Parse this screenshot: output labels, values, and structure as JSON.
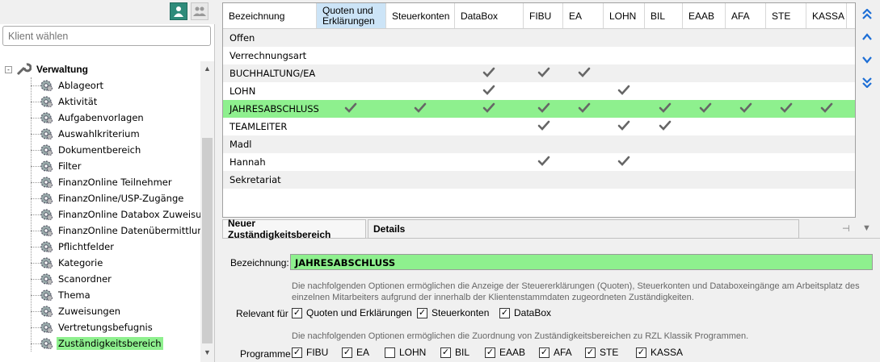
{
  "search": {
    "placeholder": "Klient wählen"
  },
  "tree": {
    "root": "Verwaltung",
    "items": [
      "Ablageort",
      "Aktivität",
      "Aufgabenvorlagen",
      "Auswahlkriterium",
      "Dokumentbereich",
      "Filter",
      "FinanzOnline Teilnehmer",
      "FinanzOnline/USP-Zugänge",
      "FinanzOnline Databox Zuweisungen",
      "FinanzOnline Datenübermittlungen",
      "Pflichtfelder",
      "Kategorie",
      "Scanordner",
      "Thema",
      "Zuweisungen",
      "Vertretungsbefugnis",
      "Zuständigkeitsbereich"
    ],
    "selected": "Zuständigkeitsbereich"
  },
  "grid": {
    "columns": [
      "Bezeichnung",
      "Quoten und Erklärungen",
      "Steuerkonten",
      "DataBox",
      "FIBU",
      "EA",
      "LOHN",
      "BIL",
      "EAAB",
      "AFA",
      "STE",
      "KASSA"
    ],
    "rows": [
      {
        "label": "Offen",
        "checks": [
          0,
          0,
          0,
          0,
          0,
          0,
          0,
          0,
          0,
          0,
          0
        ]
      },
      {
        "label": "Verrechnungsart",
        "checks": [
          0,
          0,
          0,
          0,
          0,
          0,
          0,
          0,
          0,
          0,
          0
        ]
      },
      {
        "label": "BUCHHALTUNG/EA",
        "checks": [
          0,
          0,
          1,
          1,
          1,
          0,
          0,
          0,
          0,
          0,
          0
        ]
      },
      {
        "label": "LOHN",
        "checks": [
          0,
          0,
          1,
          0,
          0,
          1,
          0,
          0,
          0,
          0,
          0
        ]
      },
      {
        "label": "JAHRESABSCHLUSS",
        "checks": [
          1,
          1,
          1,
          1,
          1,
          0,
          1,
          1,
          1,
          1,
          1
        ]
      },
      {
        "label": "TEAMLEITER",
        "checks": [
          0,
          0,
          0,
          1,
          0,
          1,
          1,
          0,
          0,
          0,
          0
        ]
      },
      {
        "label": "Madl",
        "checks": [
          0,
          0,
          0,
          0,
          0,
          0,
          0,
          0,
          0,
          0,
          0
        ]
      },
      {
        "label": "Hannah",
        "checks": [
          0,
          0,
          0,
          1,
          0,
          1,
          0,
          0,
          0,
          0,
          0
        ]
      },
      {
        "label": "Sekretariat",
        "checks": [
          0,
          0,
          0,
          0,
          0,
          0,
          0,
          0,
          0,
          0,
          0
        ]
      }
    ],
    "highlight_row": "JAHRESABSCHLUSS"
  },
  "tabs": {
    "new": "Neuer Zuständigkeitsbereich",
    "details": "Details"
  },
  "detail": {
    "bez_label": "Bezeichnung:",
    "bez_value": "JAHRESABSCHLUSS",
    "info1": "Die nachfolgenden Optionen ermöglichen die Anzeige der Steuererklärungen (Quoten), Steuerkonten und Databoxeingänge am Arbeitsplatz des einzelnen Mitarbeiters aufgrund der innerhalb der Klientenstammdaten zugeordneten Zuständigkeiten.",
    "relevant_label": "Relevant für",
    "relevant": [
      {
        "label": "Quoten und Erklärungen",
        "checked": true
      },
      {
        "label": "Steuerkonten",
        "checked": true
      },
      {
        "label": "DataBox",
        "checked": true
      }
    ],
    "info2": "Die nachfolgenden Optionen ermöglichen die Zuordnung von Zuständigkeitsbereichen zu RZL Klassik Programmen.",
    "programme_label": "Programme",
    "programme": [
      {
        "label": "FIBU",
        "checked": true
      },
      {
        "label": "EA",
        "checked": true
      },
      {
        "label": "LOHN",
        "checked": false
      },
      {
        "label": "BIL",
        "checked": true
      },
      {
        "label": "EAAB",
        "checked": true
      },
      {
        "label": "AFA",
        "checked": true
      },
      {
        "label": "STE",
        "checked": true
      },
      {
        "label": "KASSA",
        "checked": true
      }
    ]
  },
  "colors": {
    "highlight": "#8ef08e",
    "accent": "#1e6fd6"
  }
}
